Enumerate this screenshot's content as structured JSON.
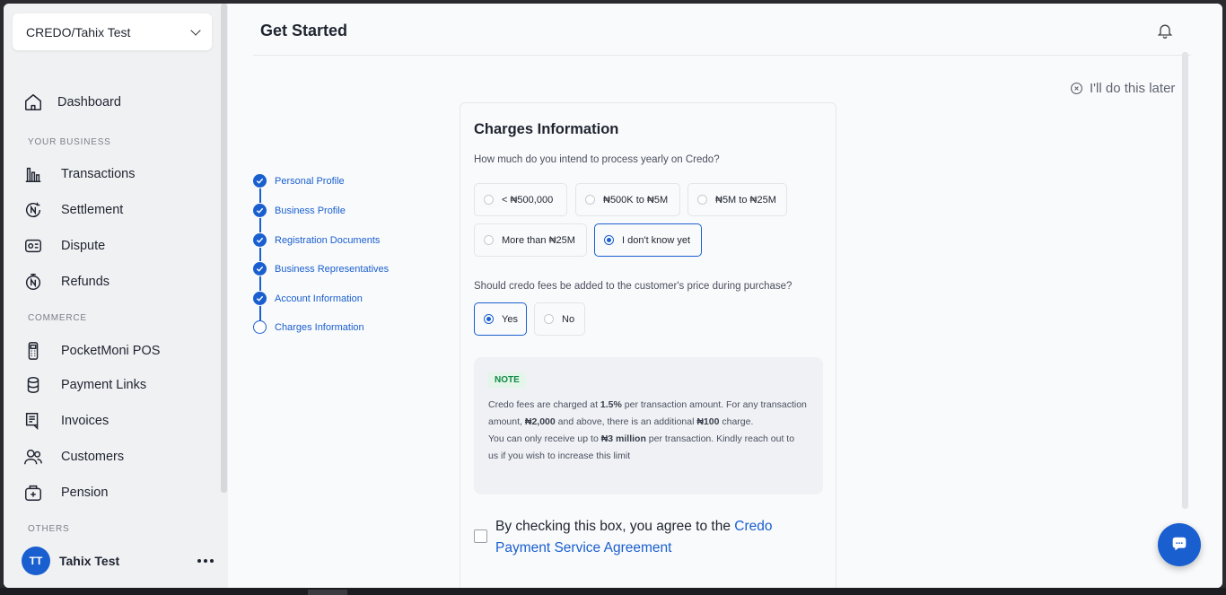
{
  "sidebar": {
    "business_name": "CREDO/Tahix Test",
    "dashboard": "Dashboard",
    "section_business": "YOUR BUSINESS",
    "transactions": "Transactions",
    "settlement": "Settlement",
    "dispute": "Dispute",
    "refunds": "Refunds",
    "section_commerce": "COMMERCE",
    "pocketmoni": "PocketMoni POS",
    "payment_links": "Payment Links",
    "invoices": "Invoices",
    "customers": "Customers",
    "pension": "Pension",
    "section_others": "OTHERS",
    "user_initials": "TT",
    "user_name": "Tahix Test"
  },
  "header": {
    "title": "Get Started",
    "do_later": "I'll do this later"
  },
  "steps": [
    {
      "label": "Personal Profile",
      "done": true
    },
    {
      "label": "Business Profile",
      "done": true
    },
    {
      "label": "Registration Documents",
      "done": true
    },
    {
      "label": "Business Representatives",
      "done": true
    },
    {
      "label": "Account Information",
      "done": true
    },
    {
      "label": "Charges Information",
      "done": false
    }
  ],
  "form": {
    "title": "Charges Information",
    "q1": "How much do you intend to process yearly on Credo?",
    "volume_options": [
      "< ₦500,000",
      "₦500K to ₦5M",
      "₦5M to ₦25M",
      "More than ₦25M",
      "I don't know yet"
    ],
    "volume_selected": "I don't know yet",
    "q2": "Should credo fees be added to the customer's price during purchase?",
    "fee_options": [
      "Yes",
      "No"
    ],
    "fee_selected": "Yes",
    "note_badge": "NOTE",
    "note_p1a": "Credo fees are charged at ",
    "note_p1b": "1.5%",
    "note_p1c": " per transaction amount. For any transaction amount, ",
    "note_p1d": "₦2,000",
    "note_p1e": " and above, there is an additional ",
    "note_p1f": "₦100",
    "note_p1g": " charge.",
    "note_p2a": "You can only receive up to ",
    "note_p2b": "₦3 million",
    "note_p2c": " per transaction. Kindly reach out to us if you wish to increase this limit",
    "agree_prefix": "By checking this box, you agree to the ",
    "agree_link": "Credo Payment Service Agreement"
  }
}
